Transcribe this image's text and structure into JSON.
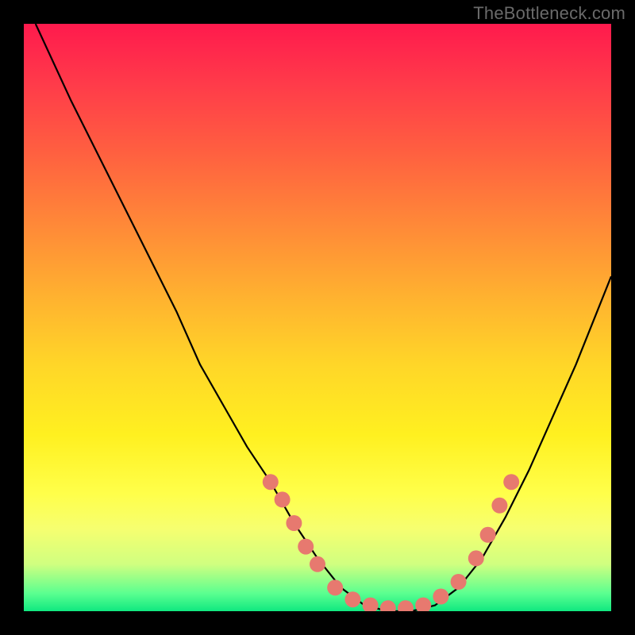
{
  "watermark": {
    "text": "TheBottleneck.com"
  },
  "chart_data": {
    "type": "line",
    "title": "",
    "xlabel": "",
    "ylabel": "",
    "xlim": [
      0,
      100
    ],
    "ylim": [
      0,
      100
    ],
    "grid": false,
    "series": [
      {
        "name": "bottleneck-curve",
        "color": "#000000",
        "x": [
          2,
          8,
          14,
          20,
          26,
          30,
          34,
          38,
          42,
          46,
          50,
          54,
          58,
          62,
          66,
          70,
          74,
          78,
          82,
          86,
          90,
          94,
          98,
          100
        ],
        "y": [
          100,
          87,
          75,
          63,
          51,
          42,
          35,
          28,
          22,
          15,
          9,
          4,
          1,
          0,
          0,
          1,
          4,
          9,
          16,
          24,
          33,
          42,
          52,
          57
        ]
      }
    ],
    "markers": [
      {
        "name": "highlight-dots",
        "color": "#e7796f",
        "radius": 10,
        "points": [
          {
            "x": 42,
            "y": 22
          },
          {
            "x": 44,
            "y": 19
          },
          {
            "x": 46,
            "y": 15
          },
          {
            "x": 48,
            "y": 11
          },
          {
            "x": 50,
            "y": 8
          },
          {
            "x": 53,
            "y": 4
          },
          {
            "x": 56,
            "y": 2
          },
          {
            "x": 59,
            "y": 1
          },
          {
            "x": 62,
            "y": 0.5
          },
          {
            "x": 65,
            "y": 0.5
          },
          {
            "x": 68,
            "y": 1
          },
          {
            "x": 71,
            "y": 2.5
          },
          {
            "x": 74,
            "y": 5
          },
          {
            "x": 77,
            "y": 9
          },
          {
            "x": 79,
            "y": 13
          },
          {
            "x": 81,
            "y": 18
          },
          {
            "x": 83,
            "y": 22
          }
        ]
      }
    ],
    "background_gradient": {
      "stops": [
        {
          "pos": 0,
          "color": "#ff1a4d"
        },
        {
          "pos": 70,
          "color": "#fff020"
        },
        {
          "pos": 100,
          "color": "#10e880"
        }
      ]
    }
  }
}
